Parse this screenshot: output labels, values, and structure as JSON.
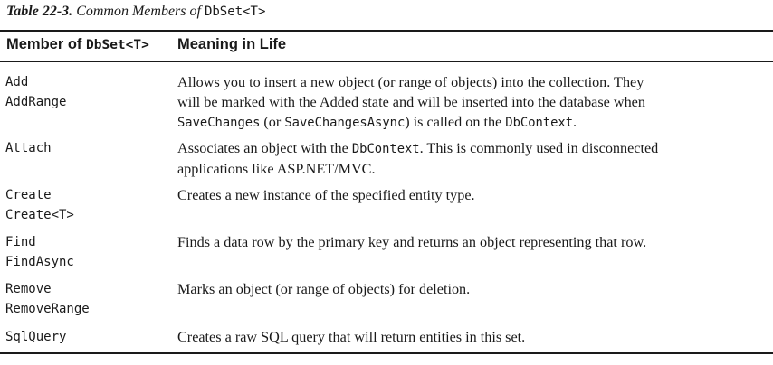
{
  "caption": {
    "label": "Table 22-3.",
    "text": "Common Members of ",
    "code": "DbSet<T>"
  },
  "header": {
    "member_prefix": "Member of ",
    "member_code": "DbSet<T>",
    "meaning": "Meaning in Life"
  },
  "rows": [
    {
      "members": [
        "Add",
        "AddRange"
      ],
      "lines": [
        [
          "Allows you to insert a new object (or range of objects) into the collection. They"
        ],
        [
          "will be marked with the Added state and will be inserted into the database when"
        ],
        [
          {
            "code": "SaveChanges"
          },
          " (or ",
          {
            "code": "SaveChangesAsync"
          },
          ") is called on the ",
          {
            "code": "DbContext"
          },
          "."
        ]
      ]
    },
    {
      "members": [
        "Attach"
      ],
      "lines": [
        [
          "Associates an object with the ",
          {
            "code": "DbContext"
          },
          ". This is commonly used in disconnected"
        ],
        [
          "applications like ASP.NET/MVC."
        ]
      ]
    },
    {
      "members": [
        "Create",
        "Create<T>"
      ],
      "lines": [
        [
          "Creates a new instance of the specified entity type."
        ]
      ]
    },
    {
      "members": [
        "Find",
        "FindAsync"
      ],
      "lines": [
        [
          "Finds a data row by the primary key and returns an object representing that row."
        ]
      ]
    },
    {
      "members": [
        "Remove",
        "RemoveRange"
      ],
      "lines": [
        [
          "Marks an object (or range of objects) for deletion."
        ]
      ]
    },
    {
      "members": [
        "SqlQuery"
      ],
      "lines": [
        [
          "Creates a raw SQL query that will return entities in this set."
        ]
      ]
    }
  ]
}
